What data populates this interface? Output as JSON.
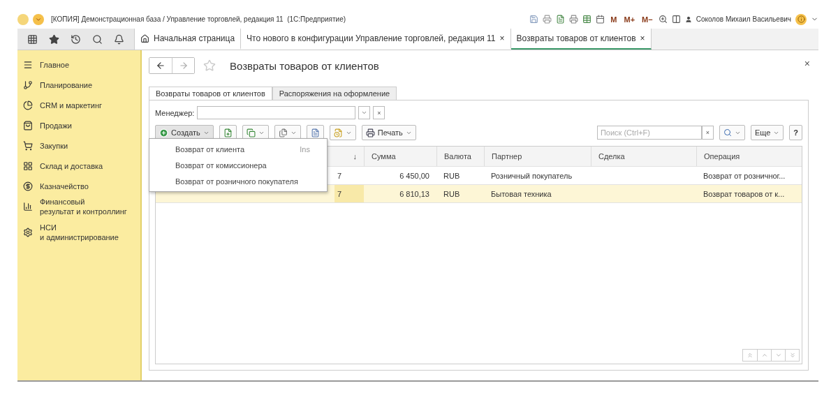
{
  "window": {
    "title": "[КОПИЯ] Демонстрационная база / Управление торговлей, редакция 11  (1С:Предприятие)",
    "memory_buttons": [
      "M",
      "M+",
      "M−"
    ],
    "user": "Соколов Михаил Васильевич"
  },
  "open_tabs": [
    {
      "kind": "home",
      "label": "Начальная страница",
      "selected": false
    },
    {
      "kind": "page",
      "label": "Что нового в конфигурации Управление торговлей, редакция 11",
      "close": "×",
      "selected": false
    },
    {
      "kind": "page",
      "label": "Возвраты товаров от клиентов",
      "close": "×",
      "selected": true
    }
  ],
  "sidebar": {
    "items": [
      {
        "label": "Главное"
      },
      {
        "label": "Планирование"
      },
      {
        "label": "CRM и маркетинг"
      },
      {
        "label": "Продажи"
      },
      {
        "label": "Закупки"
      },
      {
        "label": "Склад и доставка"
      },
      {
        "label": "Казначейство"
      },
      {
        "label": "Финансовый\nрезультат и контроллинг"
      },
      {
        "label": "НСИ\nи администрирование"
      }
    ]
  },
  "form": {
    "title": "Возвраты товаров от клиентов",
    "close": "×",
    "tabs": [
      {
        "label": "Возвраты товаров от клиентов",
        "selected": true
      },
      {
        "label": "Распоряжения на оформление",
        "selected": false
      }
    ],
    "filter": {
      "label": "Менеджер:",
      "clear": "×"
    },
    "toolbar": {
      "create": "Создать",
      "print": "Печать",
      "search_placeholder": "Поиск (Ctrl+F)",
      "search_clear": "×",
      "more": "Еще",
      "help": "?"
    },
    "create_menu": [
      {
        "label": "Возврат от клиента",
        "shortcut": "Ins"
      },
      {
        "label": "Возврат от комиссионера"
      },
      {
        "label": "Возврат от розничного покупателя"
      }
    ],
    "table": {
      "columns": [
        "↓",
        "Сумма",
        "Валюта",
        "Партнер",
        "Сделка",
        "Операция"
      ],
      "rows": [
        {
          "selected": false,
          "column_1": "7",
          "amount": "6 450,00",
          "currency": "RUB",
          "partner": "Розничный покупатель",
          "operation": "Возврат от розничног..."
        },
        {
          "selected": true,
          "column_1": "7",
          "amount": "6 810,13",
          "currency": "RUB",
          "partner": "Бытовая техника",
          "operation": "Возврат товаров от к..."
        }
      ]
    }
  }
}
